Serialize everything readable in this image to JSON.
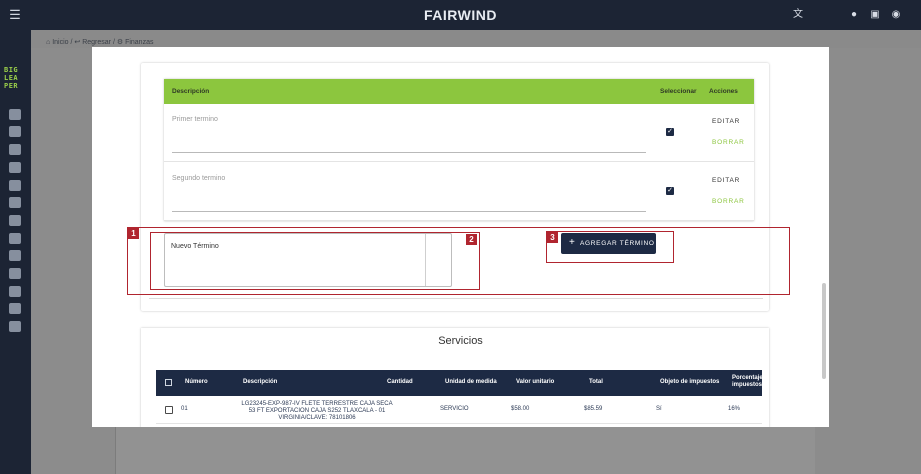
{
  "header": {
    "brand": "FAIRWIND",
    "icons": [
      "menu-icon",
      "translate-icon",
      "bell-icon",
      "chat-icon",
      "account-icon"
    ]
  },
  "sidebar": {
    "logo_lines": [
      "BIG",
      "LEA",
      "PER"
    ],
    "icons": [
      "clipboard-icon",
      "info-icon",
      "check-icon",
      "box-icon",
      "tag-icon",
      "list-icon",
      "route-icon",
      "send-icon",
      "palette-icon",
      "card-icon",
      "help-icon",
      "search-icon",
      "book-icon"
    ]
  },
  "breadcrumb": {
    "home": "Inicio",
    "back": "Regresar",
    "current": "Finanzas"
  },
  "terms": {
    "headers": {
      "description": "Descripción",
      "select": "Seleccionar",
      "actions": "Acciones"
    },
    "rows": [
      {
        "label": "Primer termino",
        "edit": "EDITAR",
        "delete": "BORRAR"
      },
      {
        "label": "Segundo termino",
        "edit": "EDITAR",
        "delete": "BORRAR"
      }
    ],
    "new_term_label": "Nuevo Término",
    "add_button": "AGREGAR TÉRMINO"
  },
  "annotations": [
    "1",
    "2",
    "3"
  ],
  "services": {
    "title": "Servicios",
    "headers": {
      "number": "Número",
      "description": "Descripción",
      "quantity": "Cantidad",
      "unit": "Unidad de medida",
      "unit_value": "Valor unitario",
      "total": "Total",
      "tax_object": "Objeto de impuestos",
      "tax_percent_1": "Porcentaje",
      "tax_percent_2": "impuestos"
    },
    "rows": [
      {
        "number": "01",
        "description": "LG23245-EXP-987-IV FLETE TERRESTRE CAJA SECA 53 FT EXPORTACION CAJA S252 TLAXCALA - 01 VIRGINIA/CLAVE: 78101806",
        "unit": "SERVICIO",
        "unit_value": "$58.00",
        "total": "$85.59",
        "tax_object": "Sí",
        "tax_percent": "16%"
      }
    ]
  },
  "colors": {
    "topbar": "#1c2434",
    "accent_green": "#8cc63e",
    "navy": "#1d2a44",
    "annotation_red": "#b0252f"
  }
}
